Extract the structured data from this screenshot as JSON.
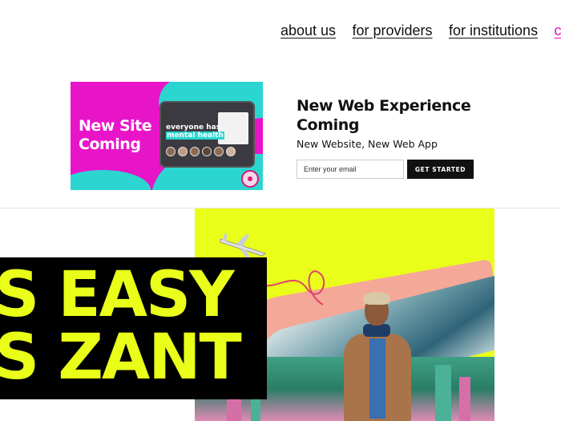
{
  "nav": {
    "items": [
      "about us",
      "for providers",
      "for institutions",
      "c"
    ]
  },
  "promo": {
    "image_title_line1": "New Site",
    "image_title_line2": "Coming",
    "tablet_text_line1": "everyone has",
    "tablet_text_line2": "mental health",
    "heading": "New Web Experience Coming",
    "subheading": "New Website, New Web App",
    "email_placeholder": "Enter your email",
    "cta_label": "GET STARTED"
  },
  "hero": {
    "banner_line1": "S EASY",
    "banner_line2": "S ZANT"
  },
  "colors": {
    "magenta": "#e815c8",
    "teal": "#2bd6d0",
    "neon_yellow": "#e9ff1a",
    "black": "#000000",
    "nav_accent": "#e60fb8"
  }
}
